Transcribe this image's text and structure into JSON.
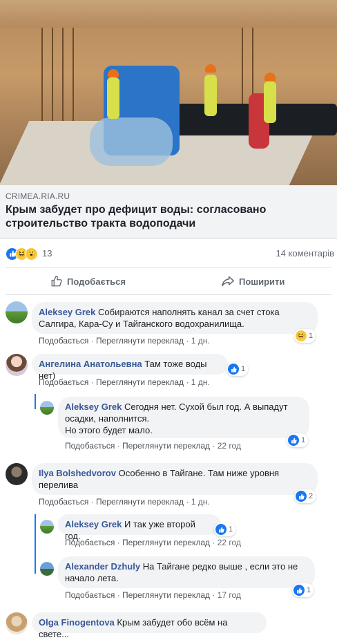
{
  "link": {
    "source": "CRIMEA.RIA.RU",
    "headline": "Крым забудет про дефицит воды: согласовано строительство тракта водоподачи"
  },
  "reactions": {
    "count": "13",
    "comments": "14 коментарів"
  },
  "actions": {
    "like": "Подобається",
    "share": "Поширити"
  },
  "meta_labels": {
    "like": "Подобається",
    "translate": "Переглянути переклад",
    "sep": "·"
  },
  "comments": [
    {
      "author": "Aleksey Grek",
      "text": "Собираются наполнять канал за счет стока Салгира, Кара-Су и Тайганского водохранилища.",
      "time": "1 дн.",
      "react_count": "1",
      "react_type": "haha"
    },
    {
      "author": "Ангелина Анатольевна",
      "text": "Там тоже воды нет)",
      "time": "1 дн.",
      "react_count": "1",
      "react_type": "like"
    },
    {
      "author": "Aleksey Grek",
      "text": "Сегодня нет. Сухой был год. А выпадут осадки, наполнится.",
      "text2": "Но этого будет мало.",
      "time": "22 год",
      "react_count": "1",
      "react_type": "like"
    },
    {
      "author": "Ilya Bolshedvorov",
      "text": "Особенно в Тайгане. Там ниже уровня перелива",
      "time": "1 дн.",
      "react_count": "2",
      "react_type": "like"
    },
    {
      "author": "Aleksey Grek",
      "text": "И так уже второй год.",
      "time": "22 год",
      "react_count": "1",
      "react_type": "like"
    },
    {
      "author": "Alexander Dzhuly",
      "text": "На Тайгане редко выше , если это не начало лета.",
      "time": "17 год",
      "react_count": "1",
      "react_type": "like"
    },
    {
      "author": "Olga Finogentova",
      "text": "Крым забудет обо всём на свете..."
    }
  ],
  "colors": {
    "like_blue": "#1877f2",
    "link_name": "#385898",
    "bubble_bg": "#f2f3f5"
  }
}
